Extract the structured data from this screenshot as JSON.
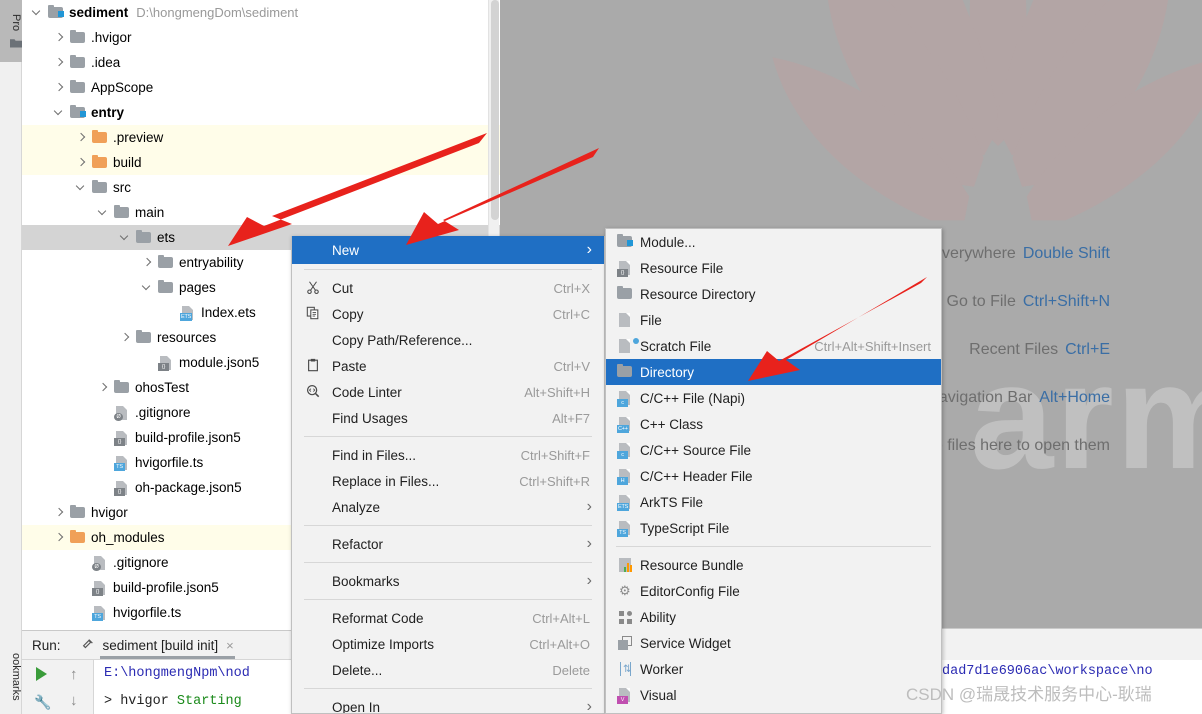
{
  "toolwindows": {
    "project_tab": "Pro",
    "bookmarks_tab": "ookmarks"
  },
  "project_tree": {
    "rows": [
      {
        "indent": 0,
        "arrow": "down",
        "icon": "module-folder-icon",
        "label": "sediment",
        "bold": true,
        "path": "D:\\hongmengDom\\sediment",
        "state": "normal"
      },
      {
        "indent": 1,
        "arrow": "right",
        "icon": "folder-icon",
        "label": ".hvigor",
        "bold": false,
        "path": "",
        "state": "normal"
      },
      {
        "indent": 1,
        "arrow": "right",
        "icon": "folder-icon",
        "label": ".idea",
        "bold": false,
        "path": "",
        "state": "normal"
      },
      {
        "indent": 1,
        "arrow": "right",
        "icon": "folder-icon",
        "label": "AppScope",
        "bold": false,
        "path": "",
        "state": "normal"
      },
      {
        "indent": 1,
        "arrow": "down",
        "icon": "module-folder-icon",
        "label": "entry",
        "bold": true,
        "path": "",
        "state": "normal"
      },
      {
        "indent": 2,
        "arrow": "right",
        "icon": "excluded-folder-icon",
        "label": ".preview",
        "bold": false,
        "path": "",
        "state": "excluded"
      },
      {
        "indent": 2,
        "arrow": "right",
        "icon": "excluded-folder-icon",
        "label": "build",
        "bold": false,
        "path": "",
        "state": "excluded"
      },
      {
        "indent": 2,
        "arrow": "down",
        "icon": "folder-icon",
        "label": "src",
        "bold": false,
        "path": "",
        "state": "normal"
      },
      {
        "indent": 3,
        "arrow": "down",
        "icon": "folder-icon",
        "label": "main",
        "bold": false,
        "path": "",
        "state": "normal"
      },
      {
        "indent": 4,
        "arrow": "down",
        "icon": "folder-icon",
        "label": "ets",
        "bold": false,
        "path": "",
        "state": "selected"
      },
      {
        "indent": 5,
        "arrow": "right",
        "icon": "folder-icon",
        "label": "entryability",
        "bold": false,
        "path": "",
        "state": "normal"
      },
      {
        "indent": 5,
        "arrow": "down",
        "icon": "folder-icon",
        "label": "pages",
        "bold": false,
        "path": "",
        "state": "normal"
      },
      {
        "indent": 6,
        "arrow": "none",
        "icon": "ets-file-icon",
        "label": "Index.ets",
        "bold": false,
        "path": "",
        "state": "normal"
      },
      {
        "indent": 4,
        "arrow": "right",
        "icon": "folder-icon",
        "label": "resources",
        "bold": false,
        "path": "",
        "state": "normal"
      },
      {
        "indent": 5,
        "arrow": "none",
        "icon": "json5-file-icon",
        "label": "module.json5",
        "bold": false,
        "path": "",
        "state": "normal"
      },
      {
        "indent": 3,
        "arrow": "right",
        "icon": "folder-icon",
        "label": "ohosTest",
        "bold": false,
        "path": "",
        "state": "normal"
      },
      {
        "indent": 3,
        "arrow": "none",
        "icon": "gitignore-file-icon",
        "label": ".gitignore",
        "bold": false,
        "path": "",
        "state": "normal"
      },
      {
        "indent": 3,
        "arrow": "none",
        "icon": "json5-file-icon",
        "label": "build-profile.json5",
        "bold": false,
        "path": "",
        "state": "normal"
      },
      {
        "indent": 3,
        "arrow": "none",
        "icon": "ts-file-icon",
        "label": "hvigorfile.ts",
        "bold": false,
        "path": "",
        "state": "normal"
      },
      {
        "indent": 3,
        "arrow": "none",
        "icon": "json5-file-icon",
        "label": "oh-package.json5",
        "bold": false,
        "path": "",
        "state": "normal"
      },
      {
        "indent": 1,
        "arrow": "right",
        "icon": "folder-icon",
        "label": "hvigor",
        "bold": false,
        "path": "",
        "state": "normal"
      },
      {
        "indent": 1,
        "arrow": "right",
        "icon": "excluded-folder-icon",
        "label": "oh_modules",
        "bold": false,
        "path": "",
        "state": "excluded"
      },
      {
        "indent": 2,
        "arrow": "none",
        "icon": "gitignore-file-icon",
        "label": ".gitignore",
        "bold": false,
        "path": "",
        "state": "normal"
      },
      {
        "indent": 2,
        "arrow": "none",
        "icon": "json5-file-icon",
        "label": "build-profile.json5",
        "bold": false,
        "path": "",
        "state": "normal"
      },
      {
        "indent": 2,
        "arrow": "none",
        "icon": "ts-file-icon",
        "label": "hvigorfile.ts",
        "bold": false,
        "path": "",
        "state": "normal"
      }
    ]
  },
  "run_panel": {
    "label": "Run:",
    "tab_name": "sediment [build init]",
    "close": "×",
    "console": [
      {
        "text": "E:\\hongmengNpm\\nod",
        "color": "blue"
      },
      {
        "text": "> hvigor Starting",
        "color": "mixed"
      }
    ],
    "console_right": "dad7d1e6906ac\\workspace\\no"
  },
  "context_menu": {
    "items": [
      {
        "type": "item",
        "icon": "",
        "label": "New",
        "mnemonic": "N",
        "key": "",
        "submenu": true,
        "selected": true
      },
      {
        "type": "sep"
      },
      {
        "type": "item",
        "icon": "cut-icon",
        "label": "Cut",
        "mnemonic": "t",
        "key": "Ctrl+X",
        "submenu": false,
        "selected": false
      },
      {
        "type": "item",
        "icon": "copy-icon",
        "label": "Copy",
        "mnemonic": "C",
        "key": "Ctrl+C",
        "submenu": false,
        "selected": false
      },
      {
        "type": "item",
        "icon": "",
        "label": "Copy Path/Reference...",
        "mnemonic": "",
        "key": "",
        "submenu": false,
        "selected": false
      },
      {
        "type": "item",
        "icon": "paste-icon",
        "label": "Paste",
        "mnemonic": "P",
        "key": "Ctrl+V",
        "submenu": false,
        "selected": false
      },
      {
        "type": "item",
        "icon": "code-linter-icon",
        "label": "Code Linter",
        "mnemonic": "",
        "key": "Alt+Shift+H",
        "submenu": false,
        "selected": false
      },
      {
        "type": "item",
        "icon": "",
        "label": "Find Usages",
        "mnemonic": "",
        "key": "Alt+F7",
        "submenu": false,
        "selected": false
      },
      {
        "type": "sep"
      },
      {
        "type": "item",
        "icon": "",
        "label": "Find in Files...",
        "mnemonic": "",
        "key": "Ctrl+Shift+F",
        "submenu": false,
        "selected": false
      },
      {
        "type": "item",
        "icon": "",
        "label": "Replace in Files...",
        "mnemonic": "a",
        "key": "Ctrl+Shift+R",
        "submenu": false,
        "selected": false
      },
      {
        "type": "item",
        "icon": "",
        "label": "Analyze",
        "mnemonic": "z",
        "key": "",
        "submenu": true,
        "selected": false
      },
      {
        "type": "sep"
      },
      {
        "type": "item",
        "icon": "",
        "label": "Refactor",
        "mnemonic": "R",
        "key": "",
        "submenu": true,
        "selected": false
      },
      {
        "type": "sep"
      },
      {
        "type": "item",
        "icon": "",
        "label": "Bookmarks",
        "mnemonic": "",
        "key": "",
        "submenu": true,
        "selected": false
      },
      {
        "type": "sep"
      },
      {
        "type": "item",
        "icon": "",
        "label": "Reformat Code",
        "mnemonic": "R",
        "key": "Ctrl+Alt+L",
        "submenu": false,
        "selected": false
      },
      {
        "type": "item",
        "icon": "",
        "label": "Optimize Imports",
        "mnemonic": "z",
        "key": "Ctrl+Alt+O",
        "submenu": false,
        "selected": false
      },
      {
        "type": "item",
        "icon": "",
        "label": "Delete...",
        "mnemonic": "D",
        "key": "Delete",
        "submenu": false,
        "selected": false
      },
      {
        "type": "sep"
      },
      {
        "type": "item",
        "icon": "",
        "label": "Open In",
        "mnemonic": "",
        "key": "",
        "submenu": true,
        "selected": false
      }
    ]
  },
  "new_submenu": {
    "items": [
      {
        "type": "item",
        "icon": "module-folder-icon",
        "label": "Module...",
        "key": "",
        "selected": false
      },
      {
        "type": "item",
        "icon": "json5-file-icon",
        "label": "Resource File",
        "key": "",
        "selected": false
      },
      {
        "type": "item",
        "icon": "folder-icon",
        "label": "Resource Directory",
        "key": "",
        "selected": false
      },
      {
        "type": "item",
        "icon": "file-icon",
        "label": "File",
        "key": "",
        "selected": false
      },
      {
        "type": "item",
        "icon": "scratch-file-icon",
        "label": "Scratch File",
        "key": "Ctrl+Alt+Shift+Insert",
        "selected": false
      },
      {
        "type": "item",
        "icon": "folder-icon",
        "label": "Directory",
        "key": "",
        "selected": true
      },
      {
        "type": "item",
        "icon": "c-file-icon",
        "label": "C/C++ File (Napi)",
        "key": "",
        "selected": false
      },
      {
        "type": "item",
        "icon": "cpp-class-icon",
        "label": "C++ Class",
        "key": "",
        "selected": false
      },
      {
        "type": "item",
        "icon": "c-source-icon",
        "label": "C/C++ Source File",
        "key": "",
        "selected": false
      },
      {
        "type": "item",
        "icon": "h-header-icon",
        "label": "C/C++ Header File",
        "key": "",
        "selected": false
      },
      {
        "type": "item",
        "icon": "ets-file-icon",
        "label": "ArkTS File",
        "key": "",
        "selected": false
      },
      {
        "type": "item",
        "icon": "ts-file-icon",
        "label": "TypeScript File",
        "key": "",
        "selected": false
      },
      {
        "type": "sep"
      },
      {
        "type": "item",
        "icon": "resource-bundle-icon",
        "label": "Resource Bundle",
        "key": "",
        "selected": false
      },
      {
        "type": "item",
        "icon": "gear-icon",
        "label": "EditorConfig File",
        "key": "",
        "selected": false
      },
      {
        "type": "item",
        "icon": "ability-icon",
        "label": "Ability",
        "key": "",
        "selected": false
      },
      {
        "type": "item",
        "icon": "service-widget-icon",
        "label": "Service Widget",
        "key": "",
        "selected": false
      },
      {
        "type": "item",
        "icon": "worker-icon",
        "label": "Worker",
        "key": "",
        "selected": false
      },
      {
        "type": "item",
        "icon": "visual-icon",
        "label": "Visual",
        "key": "",
        "selected": false
      }
    ]
  },
  "editor_hints": {
    "rows": [
      {
        "label": "Search Everywhere",
        "key": "Double Shift"
      },
      {
        "label": "Go to File",
        "key": "Ctrl+Shift+N"
      },
      {
        "label": "Recent Files",
        "key": "Ctrl+E"
      },
      {
        "label": "Navigation Bar",
        "key": "Alt+Home"
      },
      {
        "label": "Drop files here to open them",
        "key": ""
      }
    ],
    "watermark_text": "armonyOS"
  },
  "watermark": {
    "credit": "CSDN @瑞晟技术服务中心-耿瑞"
  },
  "colors": {
    "selection_blue": "#1f6fc4",
    "excluded_yellow": "#fffde9",
    "arrow_red": "#e8221c",
    "editor_gray": "#aaaaaa",
    "tree_selected_gray": "#d4d4d4"
  }
}
